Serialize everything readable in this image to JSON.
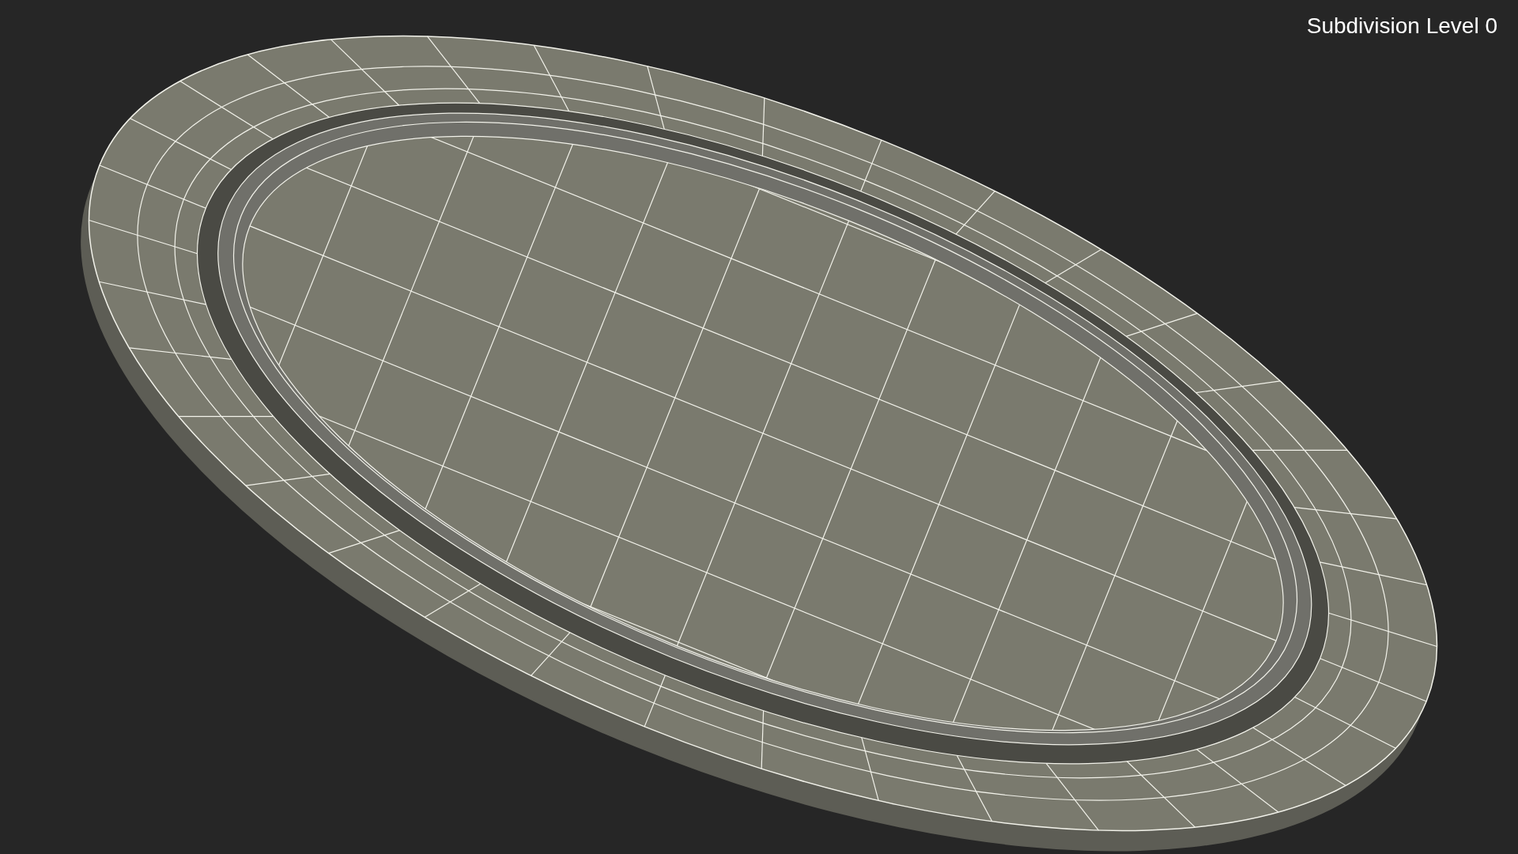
{
  "viewport": {
    "label": "Subdivision Level 0"
  }
}
